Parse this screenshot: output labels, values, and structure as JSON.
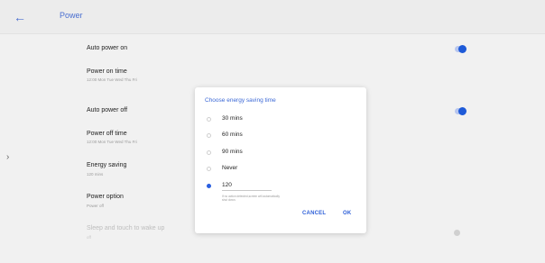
{
  "header": {
    "back_icon": "arrow-left-icon",
    "title": "Power"
  },
  "sidebar_toggle_icon": "chevron-right-icon",
  "settings": {
    "auto_power_on": {
      "label": "Auto power on",
      "enabled": true
    },
    "power_on_time": {
      "label": "Power on time",
      "value": "12:00 Mon Tue Wed Thu Fri"
    },
    "auto_power_off": {
      "label": "Auto power off",
      "enabled": true
    },
    "power_off_time": {
      "label": "Power off time",
      "value": "12:00 Mon Tue Wed Thu Fri"
    },
    "energy_saving": {
      "label": "Energy saving",
      "value": "120 mins"
    },
    "power_option": {
      "label": "Power option",
      "value": "Power off"
    },
    "sleep_touch": {
      "label": "Sleep and touch to wake up",
      "value": "off",
      "enabled": false,
      "disabled": true
    }
  },
  "dialog": {
    "title": "Choose energy saving time",
    "options": [
      {
        "label": "30 mins",
        "selected": false
      },
      {
        "label": "60 mins",
        "selected": false
      },
      {
        "label": "90 mins",
        "selected": false
      },
      {
        "label": "Never",
        "selected": false
      }
    ],
    "custom": {
      "value": "120",
      "selected": true
    },
    "hint": "If no action detected,screen will automatically shut down.",
    "cancel_label": "CANCEL",
    "ok_label": "OK"
  },
  "colors": {
    "accent": "#1e5ad8",
    "title_blue": "#4a6fd0",
    "background": "#f1f1f1"
  }
}
